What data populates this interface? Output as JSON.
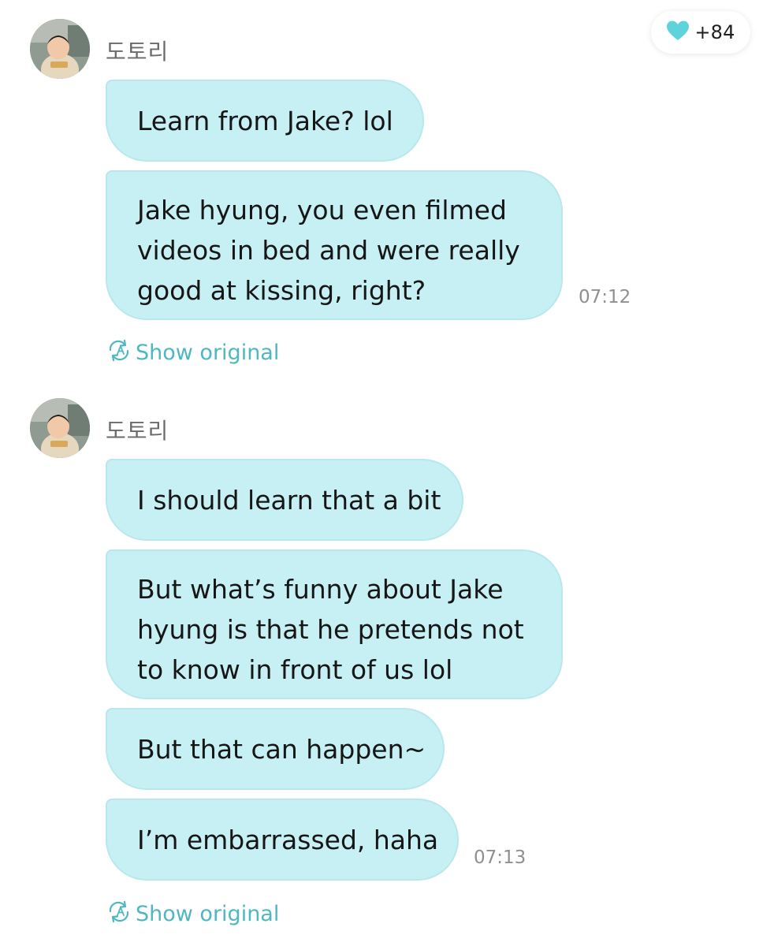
{
  "reactions": {
    "like_count": "+84",
    "icon": "heart-icon",
    "heart_color": "#5fd3dc"
  },
  "colors": {
    "bubble_bg": "#c7f0f4",
    "link": "#4fb7c2"
  },
  "message_groups": [
    {
      "sender": "도토리",
      "messages": [
        "Learn from Jake? lol",
        "Jake hyung, you even filmed videos in bed and were really good at kissing, right?"
      ],
      "time": "07:12",
      "translate_label": "Show original"
    },
    {
      "sender": "도토리",
      "messages": [
        "I should learn that a bit",
        "But what’s funny about Jake hyung is that he pretends not to know in front of us lol",
        "But that can happen~",
        "I’m embarrassed, haha"
      ],
      "time": "07:13",
      "translate_label": "Show original"
    }
  ]
}
